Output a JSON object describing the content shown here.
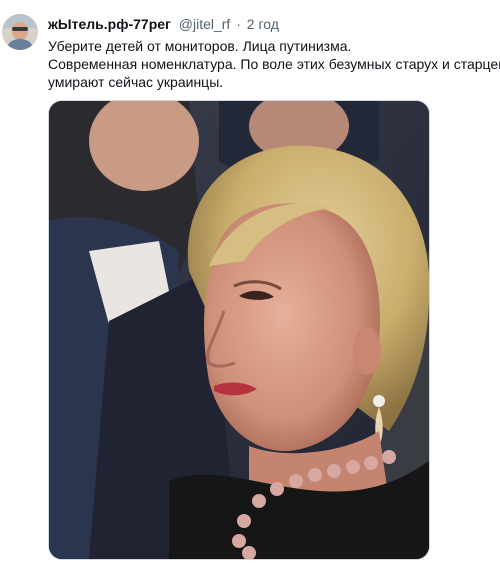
{
  "tweet": {
    "display_name": "жЫтель.рф-77рег",
    "handle": "@jitel_rf",
    "separator": "·",
    "time": "2 год",
    "text_lines": [
      "Уберите детей от мониторов. Лица путинизма.",
      "Современная номенклатура. По воле этих безумных старух и старцев",
      "умирают сейчас украинцы."
    ]
  },
  "colors": {
    "name": "#0f1419",
    "secondary": "#536471",
    "media_border": "#cfd9de"
  }
}
